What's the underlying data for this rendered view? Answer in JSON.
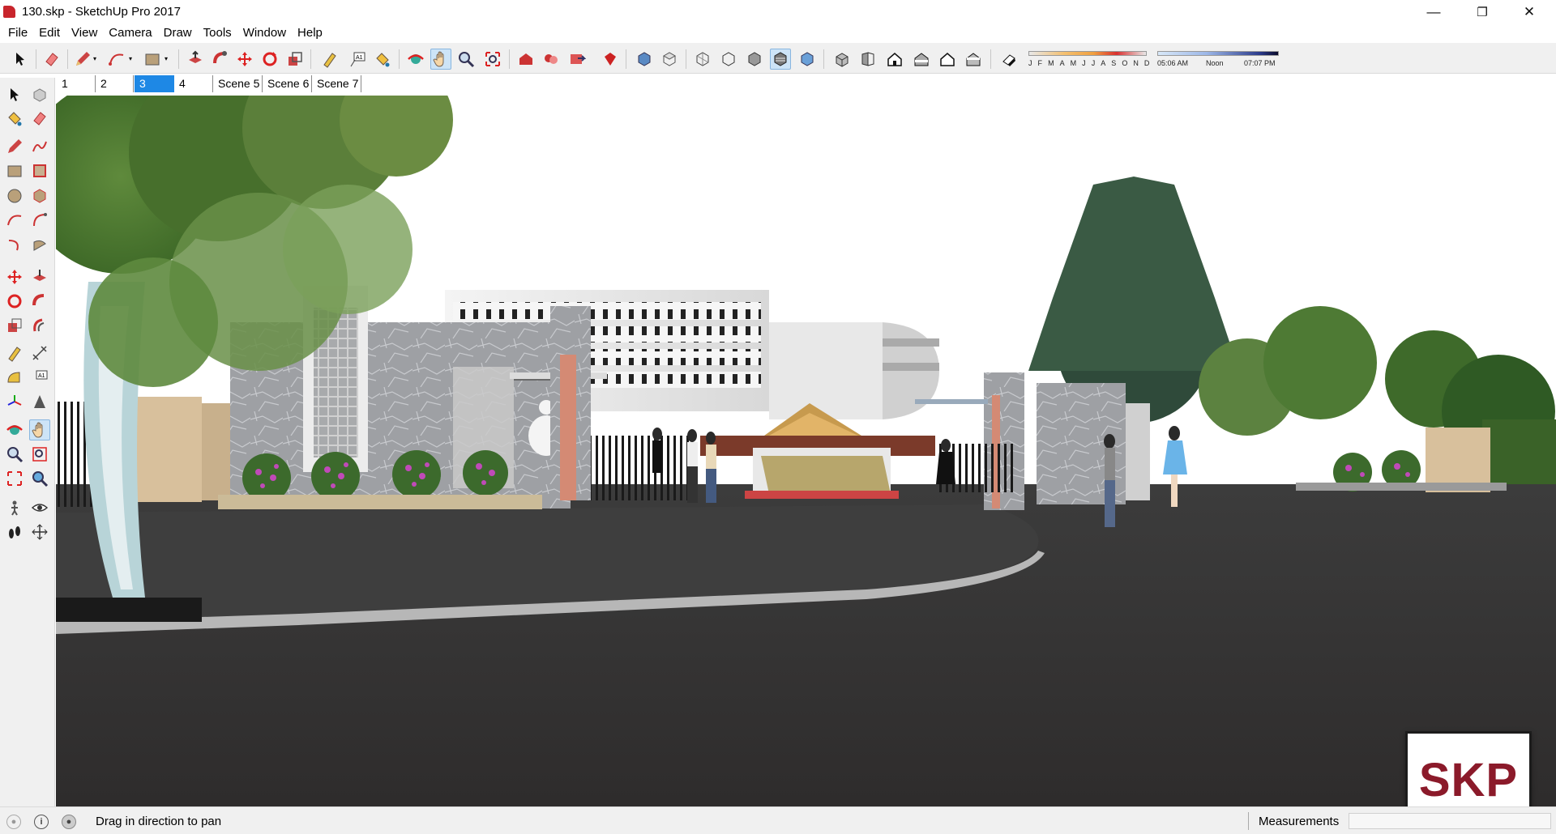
{
  "window": {
    "title": "130.skp - SketchUp Pro 2017",
    "minimize": "—",
    "maximize": "❐",
    "close": "✕"
  },
  "menu": [
    "File",
    "Edit",
    "View",
    "Camera",
    "Draw",
    "Tools",
    "Window",
    "Help"
  ],
  "toolbar": {
    "active_tool": "pan",
    "shadow": {
      "months": [
        "J",
        "F",
        "M",
        "A",
        "M",
        "J",
        "J",
        "A",
        "S",
        "O",
        "N",
        "D"
      ],
      "time_start": "05:06 AM",
      "time_mid": "Noon",
      "time_end": "07:07 PM"
    }
  },
  "scenes": {
    "tabs": [
      "1",
      "2",
      "3",
      "4",
      "Scene 5",
      "Scene 6",
      "Scene 7"
    ],
    "active_index": 2
  },
  "viewport": {
    "watermark": "SKP"
  },
  "status": {
    "hint": "Drag in direction to pan",
    "measurements_label": "Measurements",
    "measurements_value": ""
  },
  "colors": {
    "accent": "#1e88e5",
    "watermark": "#8b1a2a",
    "app_icon": "#c8252c"
  }
}
